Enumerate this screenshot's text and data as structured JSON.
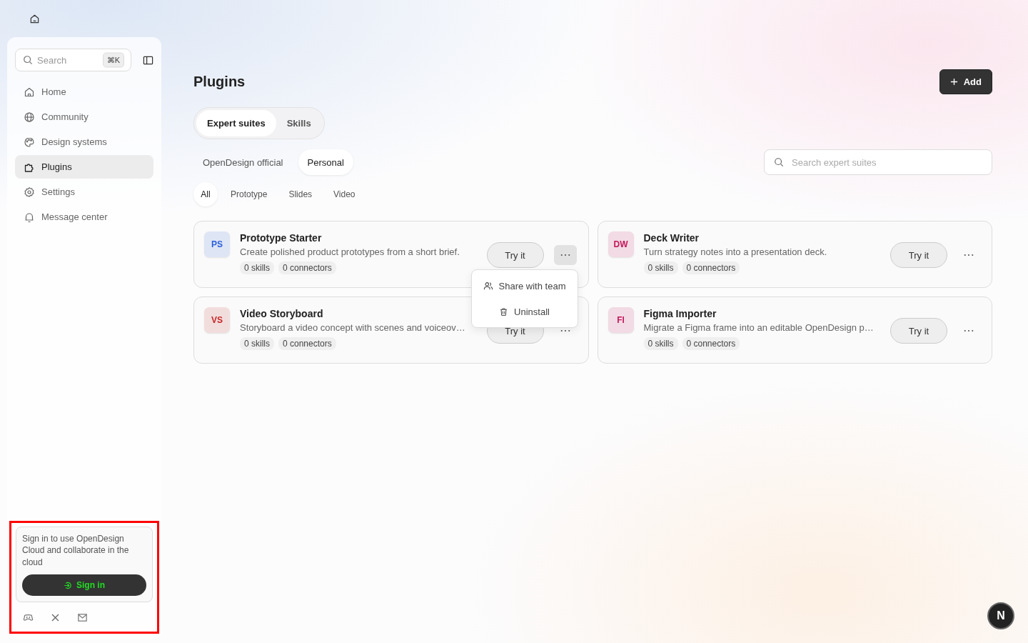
{
  "sidebar": {
    "search": {
      "placeholder": "Search",
      "shortcut": "⌘K"
    },
    "items": [
      {
        "label": "Home",
        "kind": "home",
        "selected": false
      },
      {
        "label": "Community",
        "kind": "globe",
        "selected": false
      },
      {
        "label": "Design systems",
        "kind": "palette",
        "selected": false
      },
      {
        "label": "Plugins",
        "kind": "puzzle",
        "selected": true
      },
      {
        "label": "Settings",
        "kind": "gear",
        "selected": false
      },
      {
        "label": "Message center",
        "kind": "bell",
        "selected": false
      }
    ],
    "sign_in": {
      "text": "Sign in to use OpenDesign Cloud and collaborate in the cloud",
      "button": "Sign in",
      "highlighted": true
    }
  },
  "page": {
    "title": "Plugins",
    "add_button": "Add",
    "tabs": [
      {
        "label": "Expert suites",
        "selected": true
      },
      {
        "label": "Skills",
        "selected": false
      }
    ],
    "sources": [
      {
        "label": "OpenDesign official",
        "selected": false
      },
      {
        "label": "Personal",
        "selected": true
      }
    ],
    "search": {
      "placeholder": "Search expert suites"
    },
    "categories": [
      {
        "label": "All",
        "selected": true
      },
      {
        "label": "Prototype",
        "selected": false
      },
      {
        "label": "Slides",
        "selected": false
      },
      {
        "label": "Video",
        "selected": false
      }
    ],
    "cards": [
      {
        "initials": "PS",
        "color": "#2b5fd9",
        "title": "Prototype Starter",
        "description": "Create polished product prototypes from a short brief.",
        "skills": "0 skills",
        "connectors": "0 connectors",
        "button": "Try it",
        "menu_open": true,
        "menu": [
          {
            "label": "Share with team",
            "kind": "share"
          },
          {
            "label": "Uninstall",
            "kind": "trash"
          }
        ]
      },
      {
        "initials": "DW",
        "color": "#c2185b",
        "title": "Deck Writer",
        "description": "Turn strategy notes into a presentation deck.",
        "skills": "0 skills",
        "connectors": "0 connectors",
        "button": "Try it",
        "menu_open": false
      },
      {
        "initials": "VS",
        "color": "#c62828",
        "title": "Video Storyboard",
        "description": "Storyboard a video concept with scenes and voiceov…",
        "skills": "0 skills",
        "connectors": "0 connectors",
        "button": "Try it",
        "menu_open": false
      },
      {
        "initials": "FI",
        "color": "#c2185b",
        "title": "Figma Importer",
        "description": "Migrate a Figma frame into an editable OpenDesign p…",
        "skills": "0 skills",
        "connectors": "0 connectors",
        "button": "Try it",
        "menu_open": false
      }
    ]
  },
  "assistant_button": "N"
}
